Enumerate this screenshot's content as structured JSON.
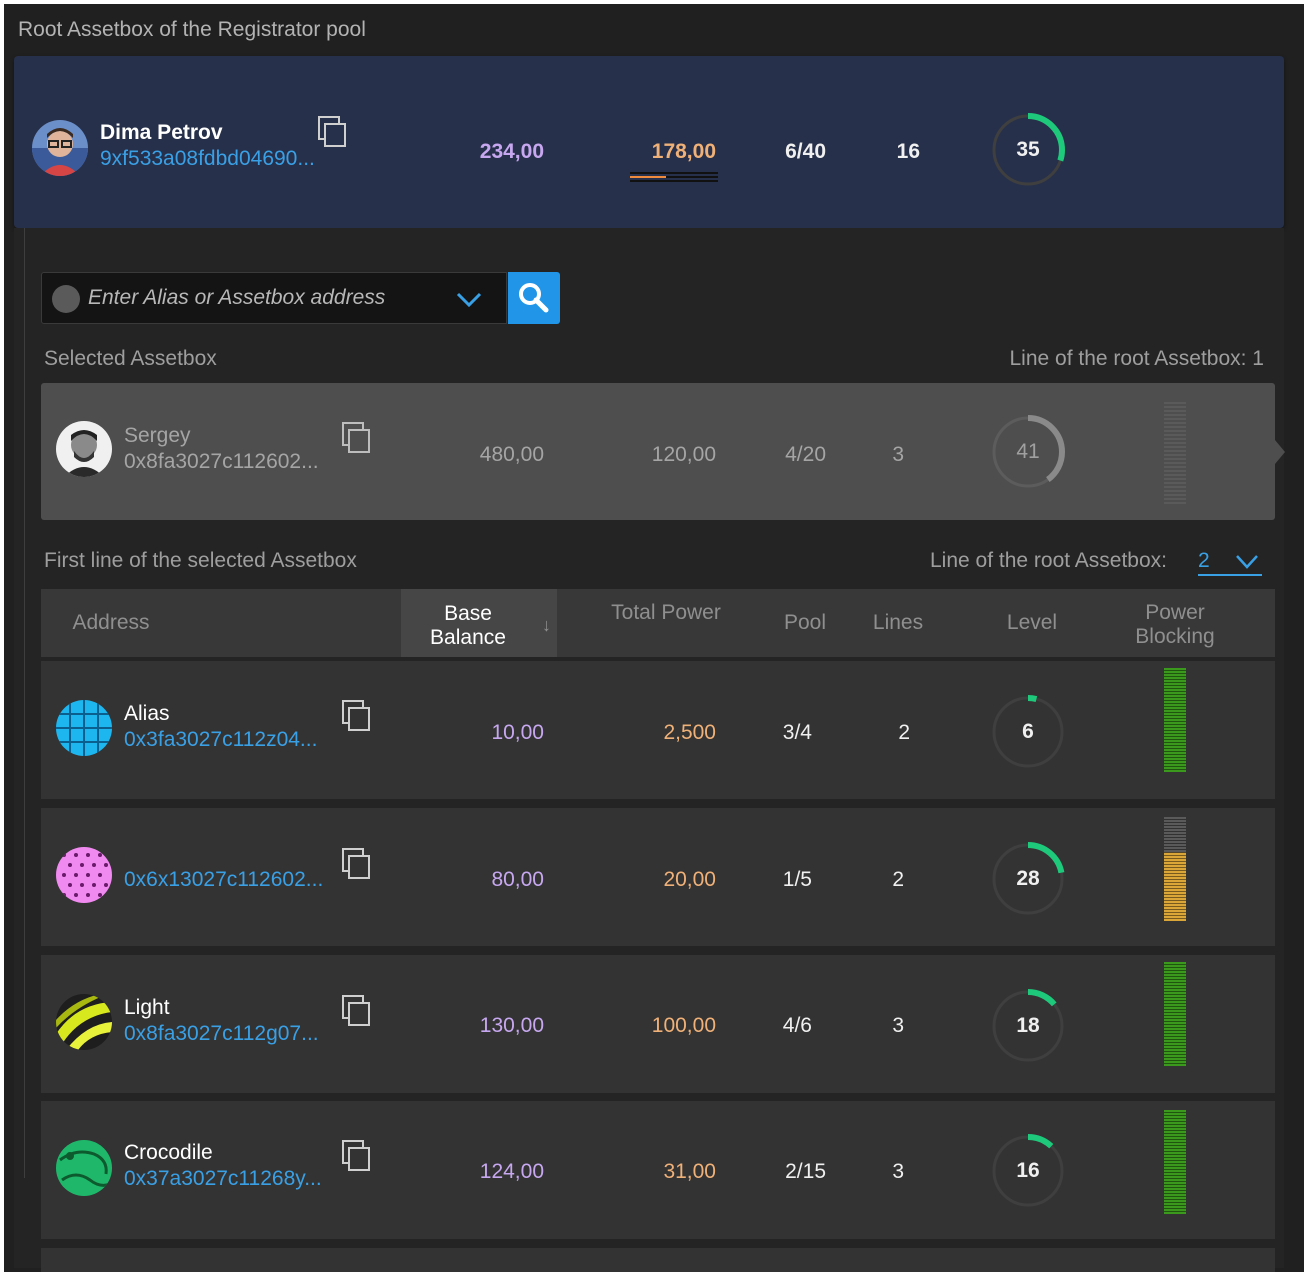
{
  "panel_title": "Root Assetbox of the Registrator pool",
  "colors": {
    "accent_blue": "#2196e8",
    "link": "#3aa0e6",
    "purple_value": "#c7a8f0",
    "orange_value": "#f0b178",
    "ring_green": "#1ec97c",
    "bar_green": "#3b9a1e",
    "bar_yellow": "#d9a637"
  },
  "root": {
    "name": "Dima Petrov",
    "address": "9xf533a08fdbd04690...",
    "base_balance": "234,00",
    "total_power": "178,00",
    "pool": "6/40",
    "lines": "16",
    "level": "35",
    "level_fraction": 0.3
  },
  "search": {
    "placeholder": "Enter Alias or Assetbox address",
    "icon": "search-icon"
  },
  "selected": {
    "section_label": "Selected Assetbox",
    "line_label": "Line of the root Assetbox: 1",
    "name": "Sergey",
    "address": "0x8fa3027c112602...",
    "base_balance": "480,00",
    "total_power": "120,00",
    "pool": "4/20",
    "lines": "3",
    "level": "41",
    "level_fraction": 0.4
  },
  "first_line": {
    "section_label": "First line of the selected Assetbox",
    "line_label": "Line of the root Assetbox:",
    "line_value": "2"
  },
  "table": {
    "headers": {
      "address": "Address",
      "base_balance": "Base Balance",
      "total_power": "Total Power",
      "pool": "Pool",
      "lines": "Lines",
      "level": "Level",
      "power_blocking": "Power Blocking"
    },
    "rows": [
      {
        "name": "Alias",
        "address": "0x3fa3027c112z04...",
        "base_balance": "10,00",
        "total_power": "2,500",
        "pool": "3/4",
        "lines": "2",
        "level": "6",
        "level_fraction": 0.04,
        "power_blocking_fraction": 1.0,
        "bar_color": "green"
      },
      {
        "name": "",
        "address": "0x6x13027c112602...",
        "base_balance": "80,00",
        "total_power": "20,00",
        "pool": "1/5",
        "lines": "2",
        "level": "28",
        "level_fraction": 0.22,
        "power_blocking_fraction": 0.66,
        "bar_color": "yellow"
      },
      {
        "name": "Light",
        "address": "0x8fa3027c112g07...",
        "base_balance": "130,00",
        "total_power": "100,00",
        "pool": "4/6",
        "lines": "3",
        "level": "18",
        "level_fraction": 0.14,
        "power_blocking_fraction": 1.0,
        "bar_color": "green"
      },
      {
        "name": "Crocodile",
        "address": "0x37a3027c11268y...",
        "base_balance": "124,00",
        "total_power": "31,00",
        "pool": "2/15",
        "lines": "3",
        "level": "16",
        "level_fraction": 0.12,
        "power_blocking_fraction": 1.0,
        "bar_color": "green"
      }
    ]
  }
}
